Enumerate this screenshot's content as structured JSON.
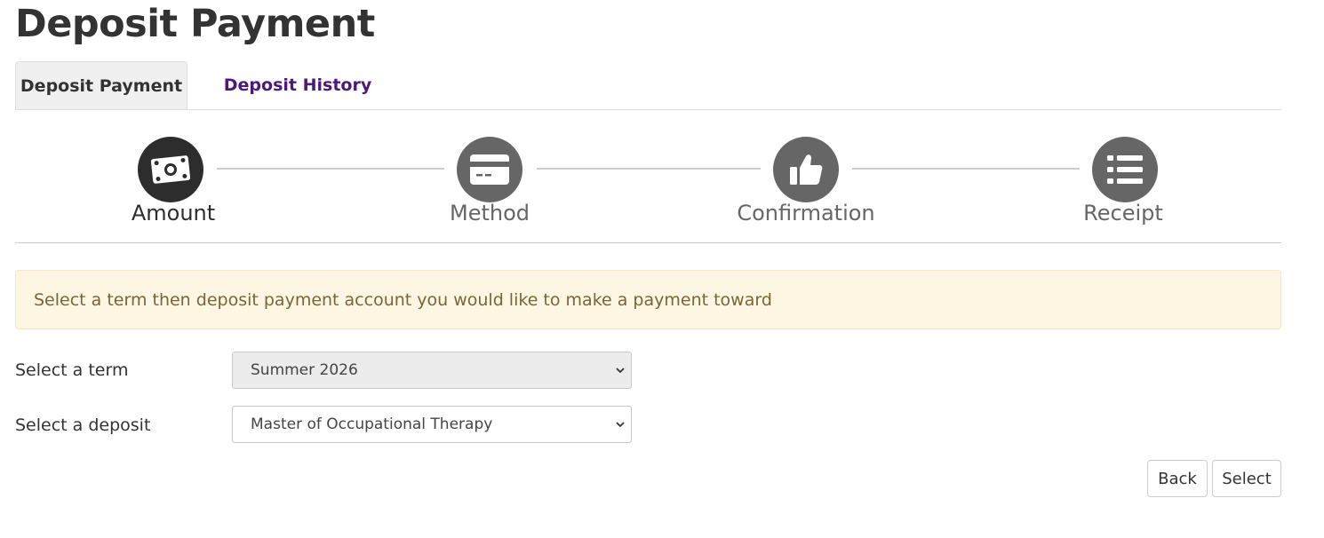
{
  "page": {
    "title": "Deposit Payment"
  },
  "tabs": [
    {
      "label": "Deposit Payment",
      "active": true
    },
    {
      "label": "Deposit History",
      "active": false
    }
  ],
  "steps": [
    {
      "label": "Amount",
      "icon": "money-bill-icon",
      "active": true
    },
    {
      "label": "Method",
      "icon": "credit-card-icon",
      "active": false
    },
    {
      "label": "Confirmation",
      "icon": "thumbs-up-icon",
      "active": false
    },
    {
      "label": "Receipt",
      "icon": "list-icon",
      "active": false
    }
  ],
  "alert": {
    "text": "Select a term then deposit payment account you would like to make a payment toward"
  },
  "form": {
    "term": {
      "label": "Select a term",
      "value": "Summer 2026",
      "disabled": true
    },
    "deposit": {
      "label": "Select a deposit",
      "value": "Master of Occupational Therapy",
      "disabled": false
    }
  },
  "buttons": {
    "back": "Back",
    "select": "Select"
  },
  "colors": {
    "tab_link": "#4e1878",
    "step_active": "#2d2d2d",
    "step_inactive": "#666666",
    "alert_bg": "#fdf6e3",
    "alert_text": "#7a6538"
  }
}
